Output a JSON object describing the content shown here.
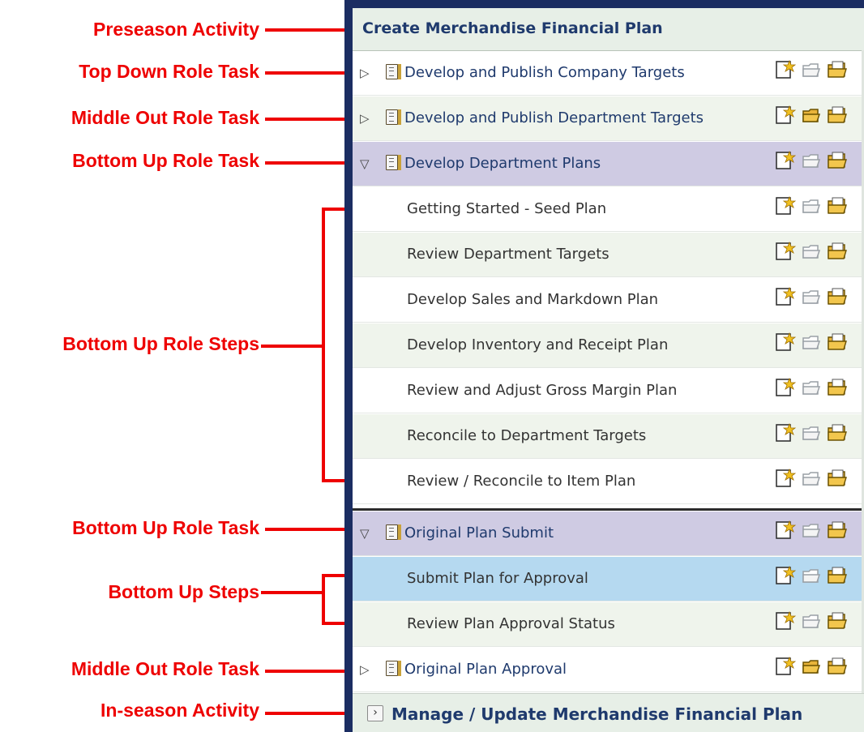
{
  "callouts": [
    {
      "id": "preseason",
      "text": "Preseason Activity"
    },
    {
      "id": "top-down-task",
      "text": "Top Down Role Task"
    },
    {
      "id": "middle-out-task-1",
      "text": "Middle Out Role Task"
    },
    {
      "id": "bottom-up-task-1",
      "text": "Bottom Up Role Task"
    },
    {
      "id": "bottom-up-steps",
      "text": "Bottom Up Role Steps"
    },
    {
      "id": "bottom-up-task-2",
      "text": "Bottom Up Role Task"
    },
    {
      "id": "bottom-up-steps-2",
      "text": "Bottom Up Steps"
    },
    {
      "id": "middle-out-task-2",
      "text": "Middle Out Role Task"
    },
    {
      "id": "inseason",
      "text": "In-season Activity"
    }
  ],
  "panel": {
    "activity_title": "Create Merchandise Financial Plan",
    "inseason_title": "Manage / Update Merchandise Financial Plan",
    "inseason_chevron": "›",
    "rows": [
      {
        "kind": "task",
        "expanded": false,
        "label": "Develop and Publish Company Targets",
        "icons": [
          "new-task-icon",
          "open-task-disabled-icon",
          "open-folder-icon"
        ]
      },
      {
        "kind": "task",
        "expanded": false,
        "label": "Develop and Publish Department Targets",
        "icons": [
          "new-task-icon",
          "open-task-icon",
          "open-folder-icon"
        ]
      },
      {
        "kind": "task",
        "expanded": true,
        "label": "Develop Department Plans",
        "icons": [
          "new-task-icon",
          "open-task-disabled-icon",
          "open-folder-icon"
        ]
      },
      {
        "kind": "step",
        "label": "Getting Started - Seed Plan"
      },
      {
        "kind": "step",
        "label": "Review Department Targets"
      },
      {
        "kind": "step",
        "label": "Develop Sales and Markdown Plan"
      },
      {
        "kind": "step",
        "label": "Develop Inventory and Receipt Plan"
      },
      {
        "kind": "step",
        "label": "Review and Adjust Gross Margin Plan"
      },
      {
        "kind": "step",
        "label": "Reconcile to Department Targets"
      },
      {
        "kind": "step",
        "label": "Review / Reconcile to Item Plan"
      },
      {
        "kind": "task",
        "expanded": true,
        "label": "Original Plan Submit"
      },
      {
        "kind": "step",
        "label": "Submit Plan for Approval",
        "selected": true
      },
      {
        "kind": "step",
        "label": "Review Plan Approval Status"
      },
      {
        "kind": "task",
        "expanded": false,
        "label": "Original Plan Approval"
      }
    ],
    "expanded_glyph": "▽",
    "collapsed_glyph": "▷"
  },
  "colors": {
    "callout_red": "#ee0000",
    "frame_navy": "#1b2d62",
    "task_text": "#1f3a6d",
    "expanded_task_row": "#cfcbe3",
    "selected_step_row": "#b5d9f0",
    "alt_row_green": "#eff4ec"
  }
}
